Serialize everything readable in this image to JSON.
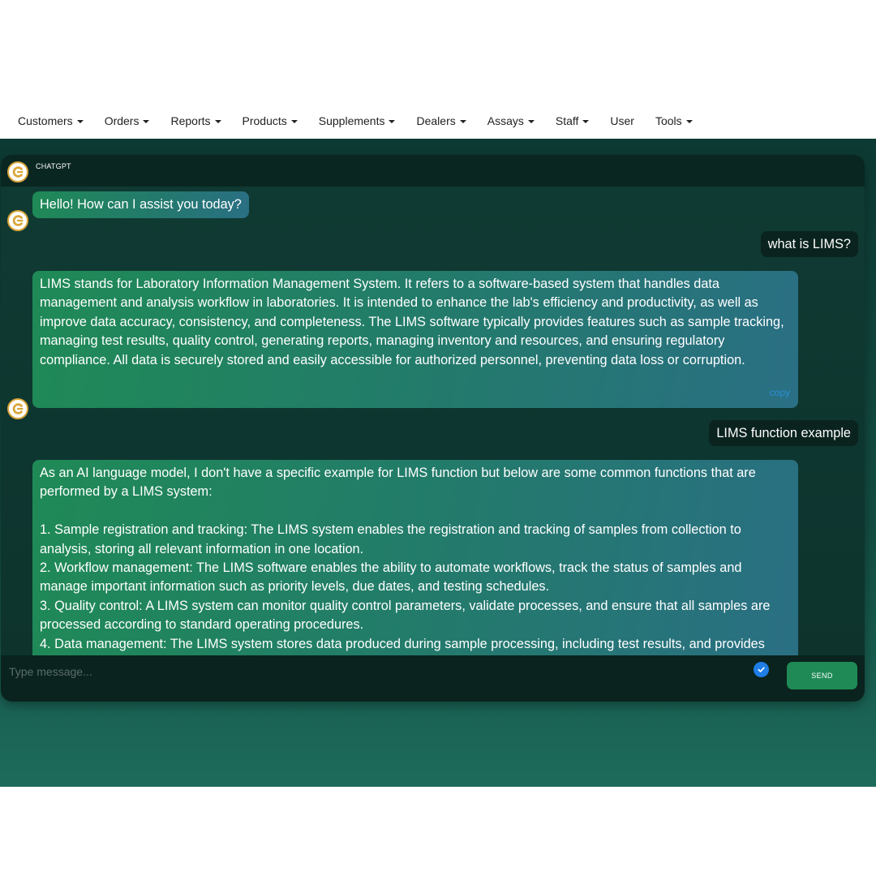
{
  "nav": {
    "items": [
      {
        "label": "Customers",
        "dropdown": true
      },
      {
        "label": "Orders",
        "dropdown": true
      },
      {
        "label": "Reports",
        "dropdown": true
      },
      {
        "label": "Products",
        "dropdown": true
      },
      {
        "label": "Supplements",
        "dropdown": true
      },
      {
        "label": "Dealers",
        "dropdown": true
      },
      {
        "label": "Assays",
        "dropdown": true
      },
      {
        "label": "Staff",
        "dropdown": true
      },
      {
        "label": "User",
        "dropdown": false
      },
      {
        "label": "Tools",
        "dropdown": true
      }
    ]
  },
  "chat": {
    "title": "CHATGPT",
    "messages": [
      {
        "role": "bot",
        "text": "Hello! How can I assist you today?"
      },
      {
        "role": "user",
        "text": "what is LIMS?"
      },
      {
        "role": "bot",
        "text": "LIMS stands for Laboratory Information Management System. It refers to a software-based system that handles data management and analysis workflow in laboratories. It is intended to enhance the lab's efficiency and productivity, as well as improve data accuracy, consistency, and completeness. The LIMS software typically provides features such as sample tracking, managing test results, quality control, generating reports, managing inventory and resources, and ensuring regulatory compliance. All data is securely stored and easily accessible for authorized personnel, preventing data loss or corruption.",
        "copy_label": "copy"
      },
      {
        "role": "user",
        "text": "LIMS function example"
      },
      {
        "role": "bot",
        "text": "As an AI language model, I don't have a specific example for LIMS function but below are some common functions that are performed by a LIMS system:\n\n1. Sample registration and tracking: The LIMS system enables the registration and tracking of samples from collection to analysis, storing all relevant information in one location.\n2. Workflow management: The LIMS software enables the ability to automate workflows, track the status of samples and manage important information such as priority levels, due dates, and testing schedules.\n3. Quality control: A LIMS system can monitor quality control parameters, validate processes, and ensure that all samples are processed according to standard operating procedures.\n4. Data management: The LIMS system stores data produced during sample processing, including test results, and provides"
      }
    ]
  },
  "input": {
    "placeholder": "Type message...",
    "send_label": "SEND"
  },
  "colors": {
    "bot_bubble_start": "#1f8a56",
    "bot_bubble_end": "#2a6f84",
    "user_bubble": "#0a231e",
    "send_button": "#1f8a56",
    "check_icon": "#1f7de6",
    "copy_link": "#2a8fd6"
  }
}
